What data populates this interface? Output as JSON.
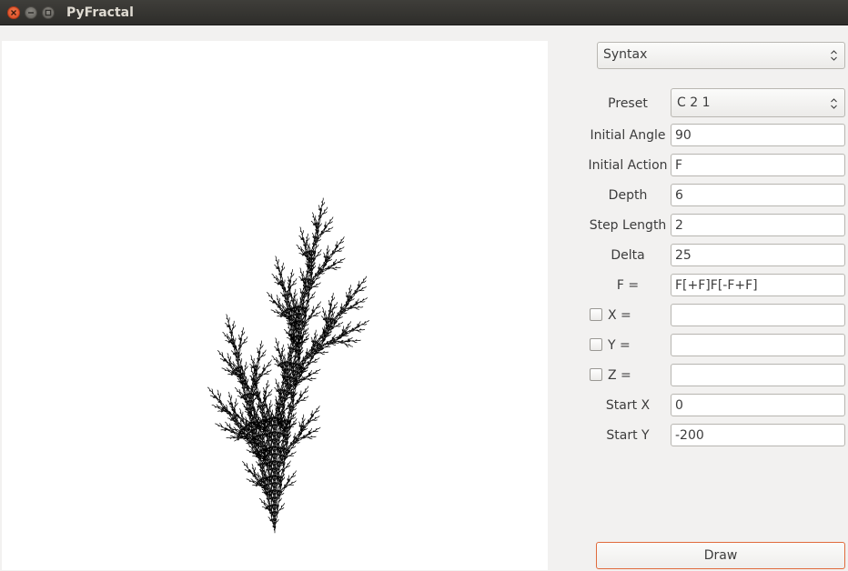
{
  "window": {
    "title": "PyFractal"
  },
  "icons": {
    "close": "close-icon",
    "minimize": "minimize-icon",
    "maximize": "maximize-icon",
    "combo_arrows": "updown-arrows-icon"
  },
  "colors": {
    "close_button": "#e95420",
    "draw_button_border": "#e06b3c",
    "canvas_bg": "#ffffff",
    "fractal_stroke": "#000000"
  },
  "mode_select": {
    "value": "Syntax"
  },
  "form": {
    "preset": {
      "label": "Preset",
      "value": "C 2 1"
    },
    "initial_angle": {
      "label": "Initial Angle",
      "value": "90"
    },
    "initial_action": {
      "label": "Initial Action",
      "value": "F"
    },
    "depth": {
      "label": "Depth",
      "value": "6"
    },
    "step_length": {
      "label": "Step Length",
      "value": "2"
    },
    "delta": {
      "label": "Delta",
      "value": "25"
    },
    "rule_f": {
      "label": "F =",
      "value": "F[+F]F[-F+F]"
    },
    "rule_x": {
      "label": "X =",
      "value": "",
      "checked": false
    },
    "rule_y": {
      "label": "Y =",
      "value": "",
      "checked": false
    },
    "rule_z": {
      "label": "Z =",
      "value": "",
      "checked": false
    },
    "start_x": {
      "label": "Start X",
      "value": "0"
    },
    "start_y": {
      "label": "Start Y",
      "value": "-200"
    }
  },
  "draw_button": {
    "label": "Draw"
  }
}
